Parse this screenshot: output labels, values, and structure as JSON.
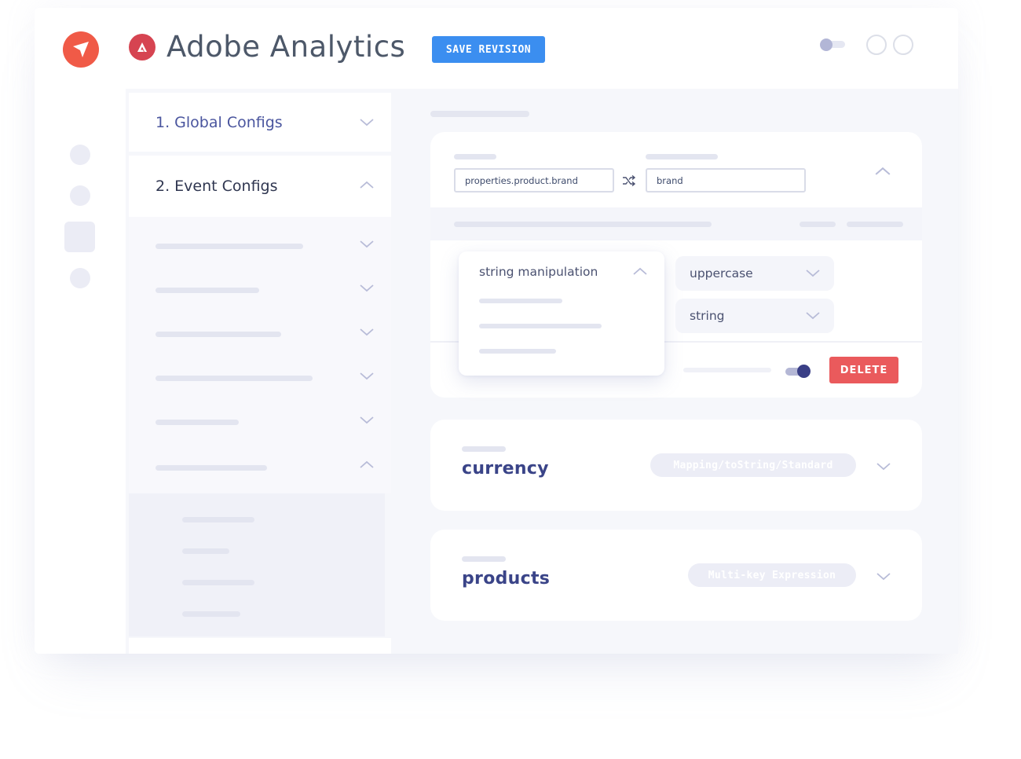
{
  "header": {
    "app_name": "Adobe Analytics",
    "save_label": "SAVE REVISION"
  },
  "sidebar": {
    "sections": [
      {
        "label": "1. Global Configs",
        "expanded": false
      },
      {
        "label": "2. Event Configs",
        "expanded": true
      }
    ],
    "sub_items_expanded": [
      false,
      false,
      false,
      false,
      false,
      true
    ]
  },
  "mapping_editor": {
    "source_field_value": "properties.product.brand",
    "target_field_value": "brand",
    "transform_dropdown": {
      "selected": "string manipulation"
    },
    "case_select": "uppercase",
    "type_select": "string",
    "enabled": true,
    "delete_label": "DELETE"
  },
  "mappings": [
    {
      "name": "currency",
      "tag": "Mapping/toString/Standard"
    },
    {
      "name": "products",
      "tag": "Multi-key Expression"
    }
  ],
  "colors": {
    "brand": "#f05a47",
    "adobe": "#d64451",
    "primary": "#3b8ef0",
    "danger": "#ea5a5c",
    "accent_text": "#3a4488"
  },
  "icons": {
    "logo": "paper-plane-icon",
    "adobe": "adobe-logo-icon",
    "swap": "shuffle-icon",
    "expand": "chevron-down-icon",
    "collapse": "chevron-up-icon"
  }
}
